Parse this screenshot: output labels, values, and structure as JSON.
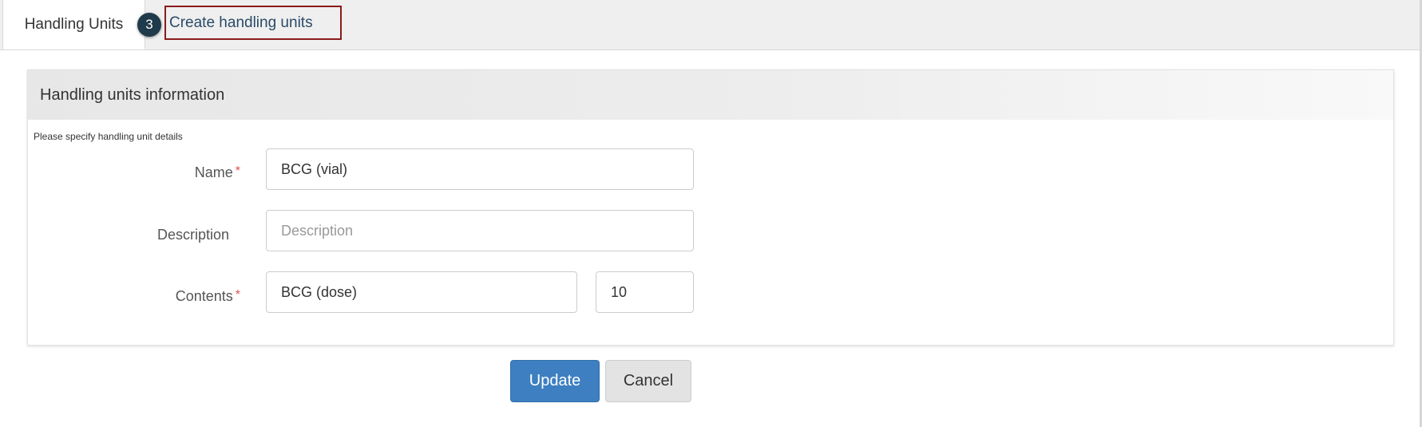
{
  "tabs": {
    "active_label": "Handling Units",
    "step_number": "3",
    "create_label": "Create handling units"
  },
  "panel": {
    "title": "Handling units information",
    "hint": "Please specify handling unit details"
  },
  "form": {
    "name": {
      "label": "Name",
      "required_marker": "*",
      "value": "BCG (vial)"
    },
    "description": {
      "label": "Description",
      "placeholder": "Description",
      "value": ""
    },
    "contents": {
      "label": "Contents",
      "required_marker": "*",
      "value": "BCG (dose)",
      "quantity": "10"
    }
  },
  "buttons": {
    "update": "Update",
    "cancel": "Cancel"
  },
  "colors": {
    "primary_button": "#3d7fc1",
    "step_badge": "#1f3a4a",
    "highlight_border": "#8b1a1a",
    "required_marker": "#d9534f"
  }
}
